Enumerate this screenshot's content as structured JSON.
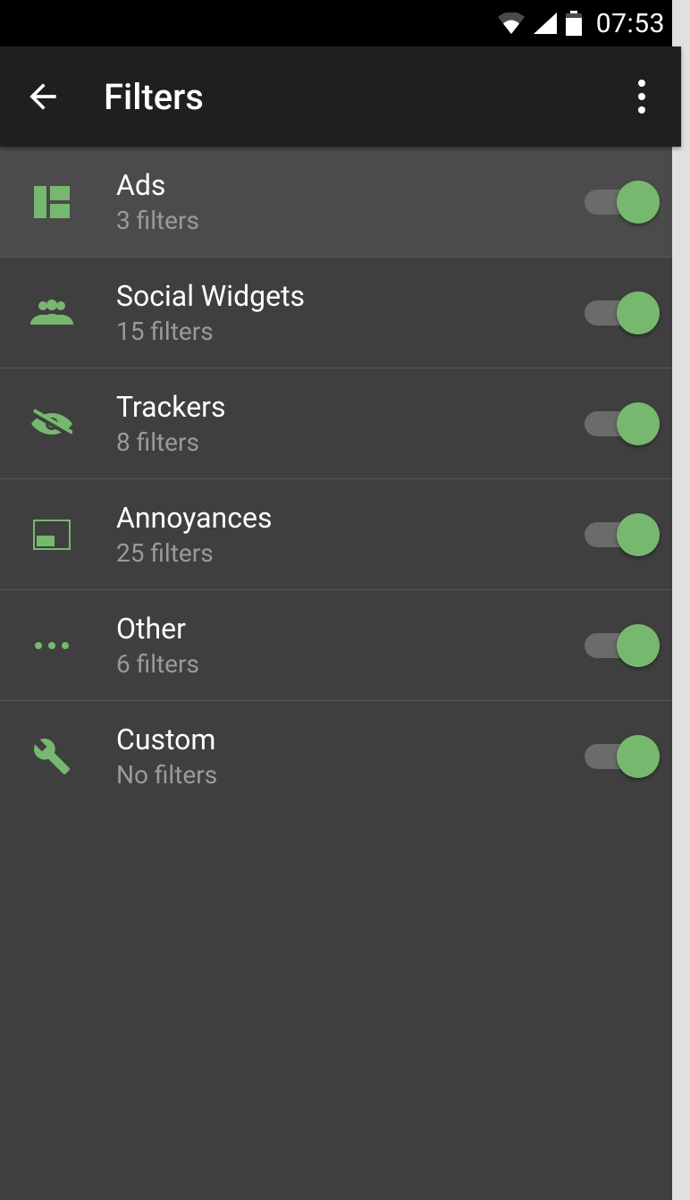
{
  "status": {
    "time": "07:53"
  },
  "appbar": {
    "title": "Filters"
  },
  "accent": "#77b86f",
  "categories": [
    {
      "icon": "dashboard-icon",
      "title": "Ads",
      "subtitle": "3 filters",
      "enabled": true
    },
    {
      "icon": "people-icon",
      "title": "Social Widgets",
      "subtitle": "15 filters",
      "enabled": true
    },
    {
      "icon": "eye-off-icon",
      "title": "Trackers",
      "subtitle": "8 filters",
      "enabled": true
    },
    {
      "icon": "window-icon",
      "title": "Annoyances",
      "subtitle": "25 filters",
      "enabled": true
    },
    {
      "icon": "dots-icon",
      "title": "Other",
      "subtitle": "6 filters",
      "enabled": true
    },
    {
      "icon": "wrench-icon",
      "title": "Custom",
      "subtitle": "No filters",
      "enabled": true
    }
  ]
}
